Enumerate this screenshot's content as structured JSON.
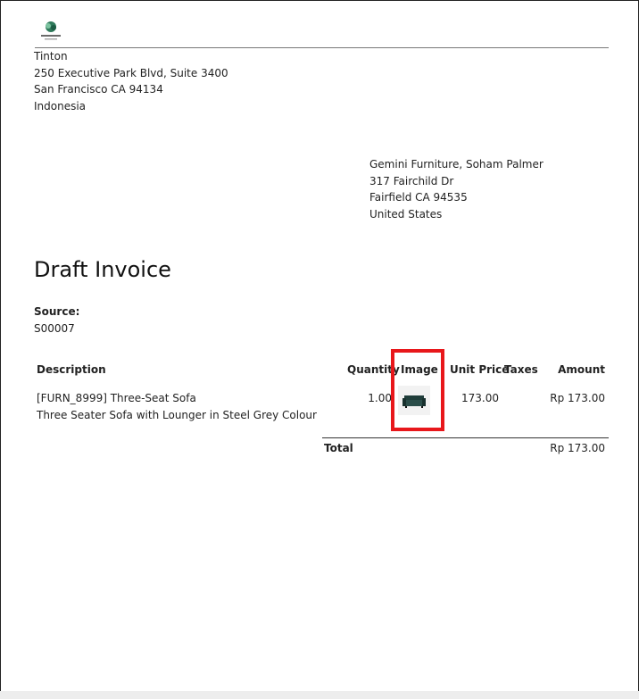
{
  "company": {
    "logo_icon": "company-logo-icon",
    "name": "Tinton",
    "street": "250 Executive Park Blvd, Suite 3400",
    "city": "San Francisco CA 94134",
    "country": "Indonesia"
  },
  "customer": {
    "name": "Gemini Furniture, Soham Palmer",
    "street": "317 Fairchild Dr",
    "city": "Fairfield CA 94535",
    "country": "United States"
  },
  "invoice": {
    "title": "Draft Invoice",
    "source_label": "Source:",
    "source_value": "S00007"
  },
  "table": {
    "headers": {
      "description": "Description",
      "quantity": "Quantity",
      "image": "Image",
      "unit_price": "Unit Price",
      "taxes": "Taxes",
      "amount": "Amount"
    },
    "rows": [
      {
        "product": "[FURN_8999] Three-Seat Sofa",
        "description": "Three Seater Sofa with Lounger in Steel Grey Colour",
        "quantity": "1.00",
        "image_icon": "sofa-image",
        "unit_price": "173.00",
        "taxes": "",
        "amount": "Rp 173.00"
      }
    ],
    "total_label": "Total",
    "total_value": "Rp 173.00"
  },
  "colors": {
    "highlight": "#e8171b",
    "text": "#222222",
    "background": "#ededed"
  }
}
